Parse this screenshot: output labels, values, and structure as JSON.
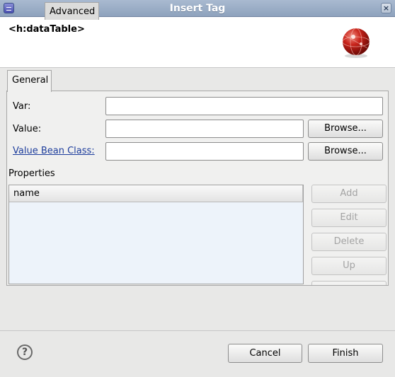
{
  "window": {
    "title": "Insert Tag"
  },
  "header": {
    "tag_name": "<h:dataTable>",
    "logo_icon": "jsf-ball-icon"
  },
  "tabs": [
    {
      "label": "General",
      "active": true
    },
    {
      "label": "Advanced",
      "active": false
    }
  ],
  "form": {
    "var_label": "Var:",
    "var_value": "",
    "value_label": "Value:",
    "value_value": "",
    "value_bean_class_label": "Value Bean Class:",
    "value_bean_class_value": "",
    "browse_label": "Browse..."
  },
  "properties": {
    "section_label": "Properties",
    "columns": [
      "name"
    ],
    "rows": [],
    "buttons": {
      "add": "Add",
      "edit": "Edit",
      "delete": "Delete",
      "up": "Up"
    }
  },
  "footer": {
    "help_icon": "help-icon",
    "cancel_label": "Cancel",
    "finish_label": "Finish"
  },
  "colors": {
    "title_bar": "#8ea2bd",
    "link": "#1d3d9c",
    "table_bg": "#edf3fa"
  }
}
